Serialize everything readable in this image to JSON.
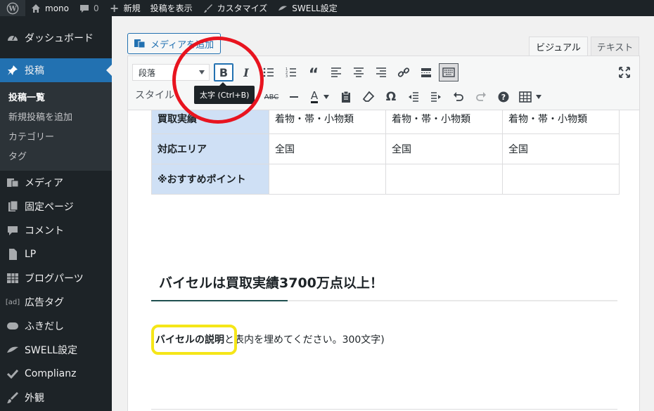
{
  "adminbar": {
    "site_name": "mono",
    "comments_count": "0",
    "new_label": "新規",
    "view_post_label": "投稿を表示",
    "customize_label": "カスタマイズ",
    "swell_label": "SWELL設定"
  },
  "sidebar": {
    "items": [
      {
        "label": "ダッシュボード",
        "icon": "dashboard-icon"
      },
      {
        "label": "投稿",
        "icon": "pin-icon"
      },
      {
        "label": "メディア",
        "icon": "media-icon"
      },
      {
        "label": "固定ページ",
        "icon": "page-icon"
      },
      {
        "label": "コメント",
        "icon": "comment-icon"
      },
      {
        "label": "LP",
        "icon": "document-icon"
      },
      {
        "label": "ブログパーツ",
        "icon": "grid-icon"
      },
      {
        "label": "広告タグ",
        "icon": "ad-icon"
      },
      {
        "label": "ふきだし",
        "icon": "bubble-icon"
      },
      {
        "label": "SWELL設定",
        "icon": "swell-icon"
      },
      {
        "label": "Complianz",
        "icon": "check-icon"
      },
      {
        "label": "外観",
        "icon": "brush-icon"
      }
    ],
    "submenu": [
      "投稿一覧",
      "新規投稿を追加",
      "カテゴリー",
      "タグ"
    ]
  },
  "editor": {
    "add_media_label": "メディアを追加",
    "tab_visual": "ビジュアル",
    "tab_text": "テキスト",
    "format_value": "段落",
    "style_label": "スタイル",
    "tooltip": "太字 (Ctrl+B)"
  },
  "table": {
    "rows": [
      {
        "header": "買取実績",
        "cells": [
          "着物・帯・小物類",
          "着物・帯・小物類",
          "着物・帯・小物類"
        ]
      },
      {
        "header": "対応エリア",
        "cells": [
          "全国",
          "全国",
          "全国"
        ]
      },
      {
        "header": "※おすすめポイント",
        "cells": [
          "",
          "",
          ""
        ]
      }
    ]
  },
  "content": {
    "heading": "バイセルは買取実績3700万点以上！",
    "para_bold": "バイセルの説明",
    "para_rest": "と表内を埋めてください。300文字)"
  },
  "colors": {
    "admin_dark": "#1d2327",
    "accent_blue": "#2271b1",
    "table_header_bg": "#cfe0f5",
    "annotation_red": "#e8141f",
    "annotation_yellow": "#f5e618"
  }
}
